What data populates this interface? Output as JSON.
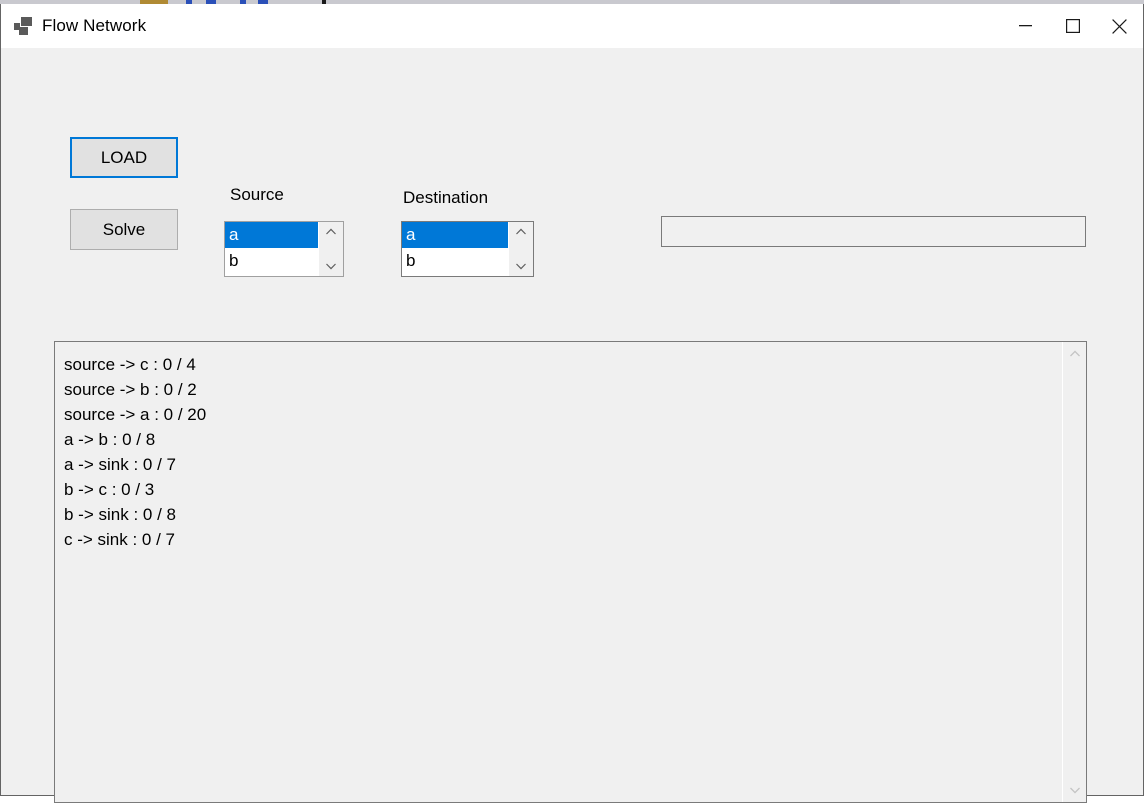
{
  "window": {
    "title": "Flow Network",
    "icon": "app-squares-icon",
    "controls": {
      "minimize": "minimize-icon",
      "maximize": "maximize-icon",
      "close": "close-icon"
    }
  },
  "colors": {
    "accent": "#0078d7",
    "form_background": "#f0f0f0",
    "titlebar_background": "#ffffff",
    "button_face": "#e1e1e1",
    "border": "#7a7a7a"
  },
  "toolbar": {
    "load_label": "LOAD",
    "solve_label": "Solve"
  },
  "source": {
    "label": "Source",
    "options": [
      "a",
      "b"
    ],
    "selected": "a",
    "scroll_up_icon": "chevron-up-icon",
    "scroll_down_icon": "chevron-down-icon"
  },
  "destination": {
    "label": "Destination",
    "options": [
      "a",
      "b"
    ],
    "selected": "a",
    "scroll_up_icon": "chevron-up-icon",
    "scroll_down_icon": "chevron-down-icon"
  },
  "result_field": {
    "value": "",
    "placeholder": ""
  },
  "output": {
    "scroll_up_icon": "chevron-up-icon",
    "scroll_down_icon": "chevron-down-icon",
    "lines": [
      "source -> c : 0 / 4",
      "source -> b : 0 / 2",
      "source -> a : 0 / 20",
      "a -> b : 0 / 8",
      "a -> sink : 0 / 7",
      "b -> c : 0 / 3",
      "b -> sink : 0 / 8",
      "c -> sink : 0 / 7"
    ]
  }
}
